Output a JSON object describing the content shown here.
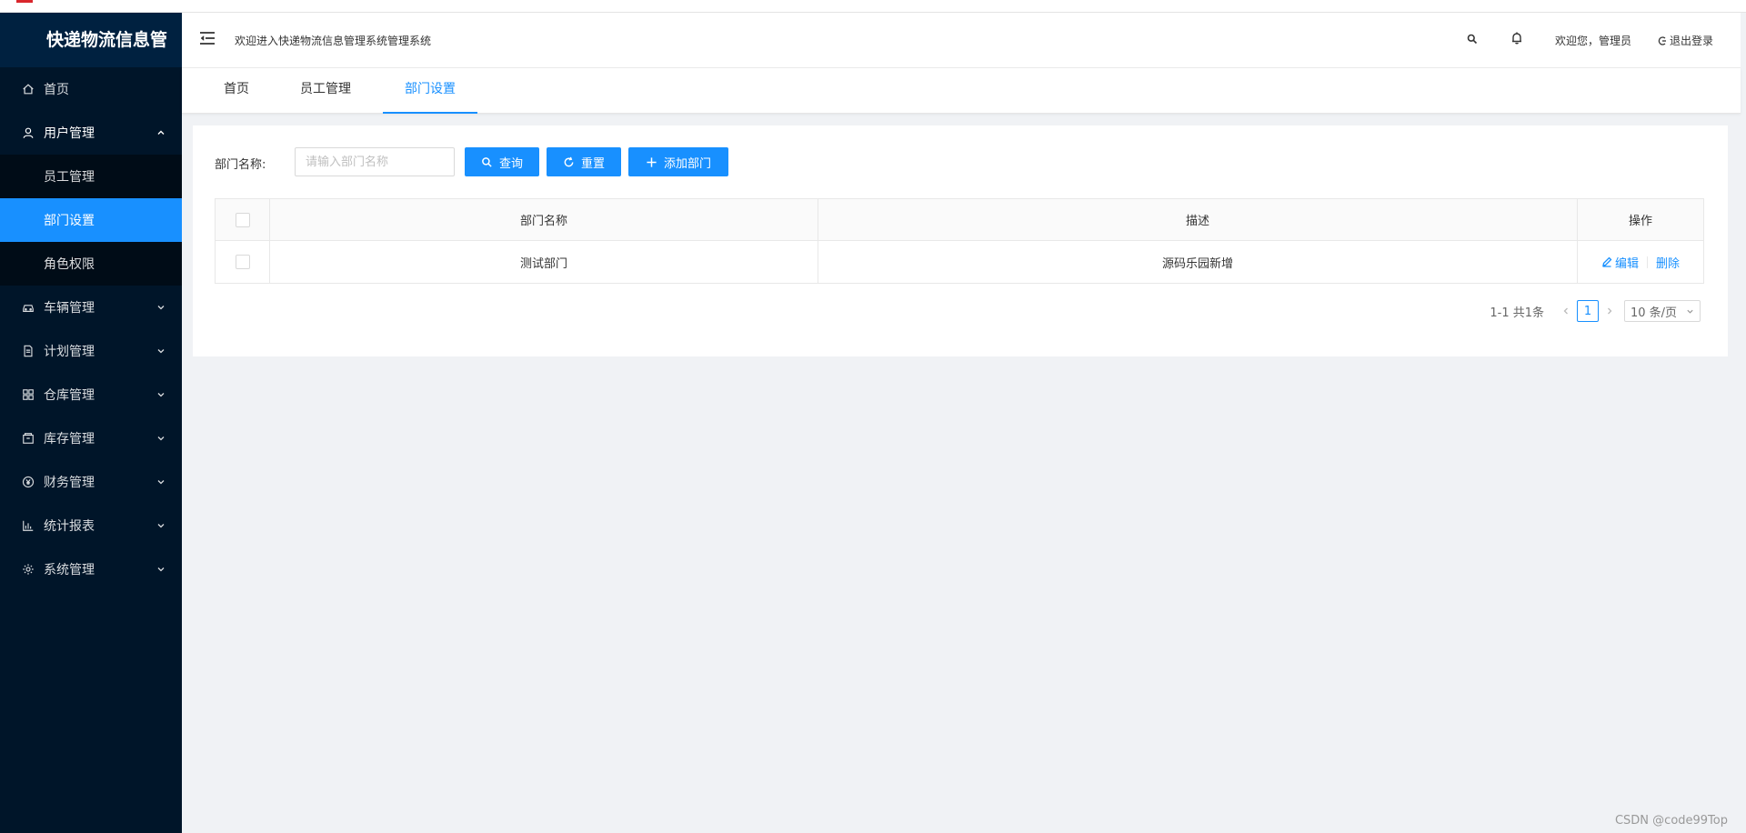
{
  "app": {
    "title": "快递物流信息管"
  },
  "sidebar": {
    "items": [
      {
        "label": "首页",
        "icon": "home-icon"
      },
      {
        "label": "用户管理",
        "icon": "user-icon",
        "open": true,
        "children": [
          {
            "label": "员工管理"
          },
          {
            "label": "部门设置",
            "active": true
          },
          {
            "label": "角色权限"
          }
        ]
      },
      {
        "label": "车辆管理",
        "icon": "car-icon"
      },
      {
        "label": "计划管理",
        "icon": "file-icon"
      },
      {
        "label": "仓库管理",
        "icon": "warehouse-icon"
      },
      {
        "label": "库存管理",
        "icon": "inventory-icon"
      },
      {
        "label": "财务管理",
        "icon": "money-icon"
      },
      {
        "label": "统计报表",
        "icon": "chart-icon"
      },
      {
        "label": "系统管理",
        "icon": "gear-icon"
      }
    ]
  },
  "header": {
    "welcome": "欢迎进入快递物流信息管理系统管理系统",
    "user_greeting": "欢迎您，管理员",
    "logout": "退出登录"
  },
  "tabs": [
    {
      "label": "首页"
    },
    {
      "label": "员工管理"
    },
    {
      "label": "部门设置",
      "active": true
    }
  ],
  "filter": {
    "label": "部门名称:",
    "placeholder": "请输入部门名称",
    "value": "",
    "query_button": "查询",
    "reset_button": "重置",
    "add_button": "添加部门"
  },
  "table": {
    "columns": [
      "部门名称",
      "描述",
      "操作"
    ],
    "rows": [
      {
        "name": "测试部门",
        "description": "源码乐园新增",
        "actions": [
          "编辑",
          "删除"
        ]
      }
    ]
  },
  "pagination": {
    "total_text": "1-1 共1条",
    "current_page": "1",
    "page_size": "10 条/页"
  },
  "colors": {
    "primary": "#1890ff",
    "sidebar_bg": "#001529",
    "submenu_bg": "#000c17",
    "content_bg": "#f0f2f5"
  },
  "watermark": "CSDN @code99Top"
}
